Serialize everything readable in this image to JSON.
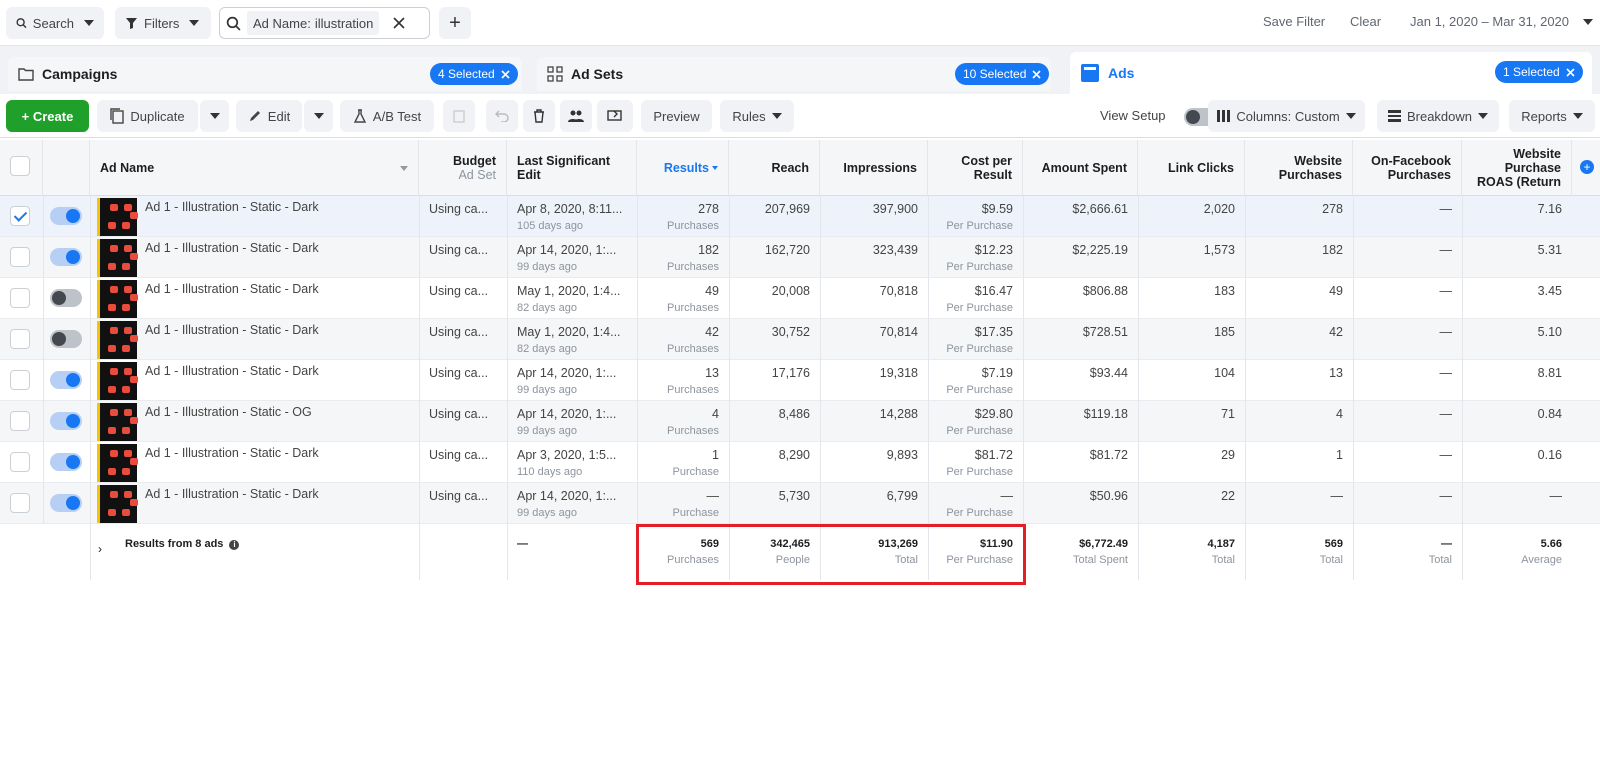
{
  "topbar": {
    "search_label": "Search",
    "filters_label": "Filters",
    "filter_chip_label": "Ad Name:",
    "filter_chip_value": "illustration",
    "plus_label": "+",
    "save_filter": "Save Filter",
    "clear": "Clear",
    "date_range": "Jan 1, 2020 – Mar 31, 2020"
  },
  "tabs": {
    "campaigns": {
      "label": "Campaigns",
      "selected": "4 Selected"
    },
    "adsets": {
      "label": "Ad Sets",
      "selected": "10 Selected"
    },
    "ads": {
      "label": "Ads",
      "selected": "1 Selected"
    }
  },
  "toolbar": {
    "create": "+ Create",
    "duplicate": "Duplicate",
    "edit": "Edit",
    "ab_test": "A/B Test",
    "preview": "Preview",
    "rules": "Rules",
    "view_setup": "View Setup",
    "columns": "Columns: Custom",
    "breakdown": "Breakdown",
    "reports": "Reports"
  },
  "columns": {
    "ad_name": "Ad Name",
    "budget": "Budget",
    "budget_sub": "Ad Set",
    "last_edit": "Last Significant Edit",
    "results": "Results",
    "reach": "Reach",
    "impressions": "Impressions",
    "cost": "Cost per Result",
    "amount": "Amount Spent",
    "clicks": "Link Clicks",
    "web_purch": "Website Purchases",
    "fb_purch": "On-Facebook Purchases",
    "roas": "Website Purchase ROAS (Return"
  },
  "rows": [
    {
      "name": "Ad 1 - Illustration - Static - Dark",
      "budget": "Using ca...",
      "edit": "Apr 8, 2020, 8:11...",
      "edit_sub": "105 days ago",
      "results": "278",
      "results_sub": "Purchases",
      "reach": "207,969",
      "impressions": "397,900",
      "cost": "$9.59",
      "cost_sub": "Per Purchase",
      "amount": "$2,666.61",
      "clicks": "2,020",
      "web": "278",
      "fb": "—",
      "roas": "7.16",
      "on": true,
      "checked": true
    },
    {
      "name": "Ad 1 - Illustration - Static - Dark",
      "budget": "Using ca...",
      "edit": "Apr 14, 2020, 1:...",
      "edit_sub": "99 days ago",
      "results": "182",
      "results_sub": "Purchases",
      "reach": "162,720",
      "impressions": "323,439",
      "cost": "$12.23",
      "cost_sub": "Per Purchase",
      "amount": "$2,225.19",
      "clicks": "1,573",
      "web": "182",
      "fb": "—",
      "roas": "5.31",
      "on": true,
      "checked": false
    },
    {
      "name": "Ad 1 - Illustration - Static - Dark",
      "budget": "Using ca...",
      "edit": "May 1, 2020, 1:4...",
      "edit_sub": "82 days ago",
      "results": "49",
      "results_sub": "Purchases",
      "reach": "20,008",
      "impressions": "70,818",
      "cost": "$16.47",
      "cost_sub": "Per Purchase",
      "amount": "$806.88",
      "clicks": "183",
      "web": "49",
      "fb": "—",
      "roas": "3.45",
      "on": false,
      "checked": false
    },
    {
      "name": "Ad 1 - Illustration - Static - Dark",
      "budget": "Using ca...",
      "edit": "May 1, 2020, 1:4...",
      "edit_sub": "82 days ago",
      "results": "42",
      "results_sub": "Purchases",
      "reach": "30,752",
      "impressions": "70,814",
      "cost": "$17.35",
      "cost_sub": "Per Purchase",
      "amount": "$728.51",
      "clicks": "185",
      "web": "42",
      "fb": "—",
      "roas": "5.10",
      "on": false,
      "checked": false
    },
    {
      "name": "Ad 1 - Illustration - Static - Dark",
      "budget": "Using ca...",
      "edit": "Apr 14, 2020, 1:...",
      "edit_sub": "99 days ago",
      "results": "13",
      "results_sub": "Purchases",
      "reach": "17,176",
      "impressions": "19,318",
      "cost": "$7.19",
      "cost_sub": "Per Purchase",
      "amount": "$93.44",
      "clicks": "104",
      "web": "13",
      "fb": "—",
      "roas": "8.81",
      "on": true,
      "checked": false
    },
    {
      "name": "Ad 1 - Illustration - Static - OG",
      "budget": "Using ca...",
      "edit": "Apr 14, 2020, 1:...",
      "edit_sub": "99 days ago",
      "results": "4",
      "results_sub": "Purchases",
      "reach": "8,486",
      "impressions": "14,288",
      "cost": "$29.80",
      "cost_sub": "Per Purchase",
      "amount": "$119.18",
      "clicks": "71",
      "web": "4",
      "fb": "—",
      "roas": "0.84",
      "on": true,
      "checked": false
    },
    {
      "name": "Ad 1 - Illustration - Static - Dark",
      "budget": "Using ca...",
      "edit": "Apr 3, 2020, 1:5...",
      "edit_sub": "110 days ago",
      "results": "1",
      "results_sub": "Purchase",
      "reach": "8,290",
      "impressions": "9,893",
      "cost": "$81.72",
      "cost_sub": "Per Purchase",
      "amount": "$81.72",
      "clicks": "29",
      "web": "1",
      "fb": "—",
      "roas": "0.16",
      "on": true,
      "checked": false
    },
    {
      "name": "Ad 1 - Illustration - Static - Dark",
      "budget": "Using ca...",
      "edit": "Apr 14, 2020, 1:...",
      "edit_sub": "99 days ago",
      "results": "—",
      "results_sub": "Purchase",
      "reach": "5,730",
      "impressions": "6,799",
      "cost": "—",
      "cost_sub": "Per Purchase",
      "amount": "$50.96",
      "clicks": "22",
      "web": "—",
      "fb": "—",
      "roas": "—",
      "on": true,
      "checked": false
    }
  ],
  "summary": {
    "label": "Results from 8 ads",
    "edit": "—",
    "results": "569",
    "results_sub": "Purchases",
    "reach": "342,465",
    "reach_sub": "People",
    "impressions": "913,269",
    "impressions_sub": "Total",
    "cost": "$11.90",
    "cost_sub": "Per Purchase",
    "amount": "$6,772.49",
    "amount_sub": "Total Spent",
    "clicks": "4,187",
    "clicks_sub": "Total",
    "web": "569",
    "web_sub": "Total",
    "fb": "—",
    "fb_sub": "Total",
    "roas": "5.66",
    "roas_sub": "Average"
  },
  "colors": {
    "accent": "#1877f2",
    "create": "#1fa02b",
    "highlight": "#e41e26"
  }
}
